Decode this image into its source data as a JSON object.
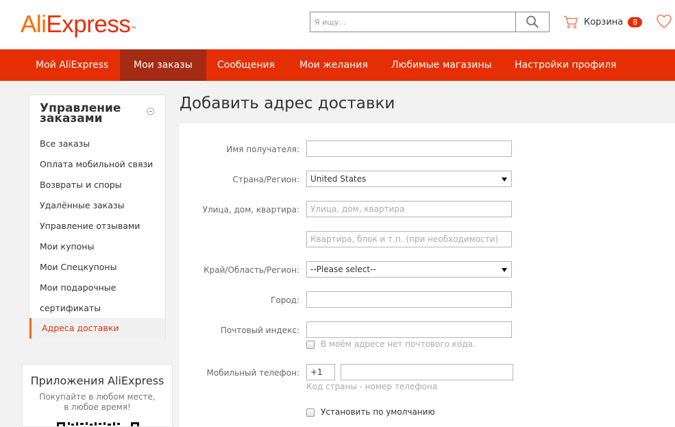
{
  "header": {
    "logo": {
      "ali": "Ali",
      "express": "Express",
      "tm": "™"
    },
    "search": {
      "placeholder": "Я ищу..."
    },
    "cart": {
      "label": "Корзина",
      "count": "8"
    }
  },
  "nav": {
    "items": [
      {
        "label": "Мой AliExpress"
      },
      {
        "label": "Мои заказы"
      },
      {
        "label": "Сообщения"
      },
      {
        "label": "Мои желания"
      },
      {
        "label": "Любимые магазины"
      },
      {
        "label": "Настройки профиля"
      }
    ],
    "active": "Мои заказы"
  },
  "sidebar": {
    "title": "Управление заказами",
    "items": [
      {
        "label": "Все заказы"
      },
      {
        "label": "Оплата мобильной связи"
      },
      {
        "label": "Возвраты и споры"
      },
      {
        "label": "Удалённые заказы"
      },
      {
        "label": "Управление отзывами"
      },
      {
        "label": "Мои купоны"
      },
      {
        "label": "Мои Спецкупоны"
      },
      {
        "label": "Мои подарочные"
      },
      {
        "label": "сертификаты"
      }
    ],
    "active_item": "Адреса доставки"
  },
  "apps": {
    "title": "Приложения AliExpress",
    "subtitle": "Покупайте в любом месте, в любое время!"
  },
  "main": {
    "title": "Добавить адрес доставки",
    "form": {
      "recipient": {
        "label": "Имя получателя:",
        "value": ""
      },
      "country": {
        "label": "Страна/Регион:",
        "value": "United States"
      },
      "street": {
        "label": "Улица, дом, квартира:",
        "placeholder": "Улица, дом, квартира"
      },
      "street2": {
        "placeholder": "Квартира, блок и т.п. (при необходимости)"
      },
      "region": {
        "label": "Край/Область/Регион:",
        "value": "--Please select--"
      },
      "city": {
        "label": "Город:",
        "value": ""
      },
      "zip": {
        "label": "Почтовый индекс:",
        "value": "",
        "no_zip_label": "В моём адресе нет почтового кода."
      },
      "phone": {
        "label": "Мобильный телефон:",
        "code": "+1",
        "number": "",
        "hint": "Код страны - номер телефона"
      },
      "default": {
        "label": "Установить по умолчанию"
      }
    }
  },
  "colors": {
    "brand_red": "#e62e04",
    "brand_orange": "#ff6a00",
    "nav_active": "#a62b14"
  }
}
